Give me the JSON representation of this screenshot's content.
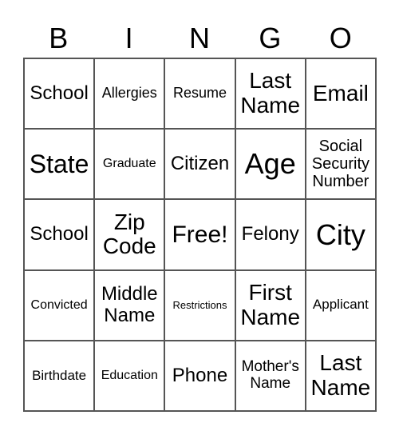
{
  "header": [
    "B",
    "I",
    "N",
    "G",
    "O"
  ],
  "cells": [
    "School",
    "Allergies",
    "Resume",
    "Last Name",
    "Email",
    "State",
    "Graduate",
    "Citizen",
    "Age",
    "Social Security Number",
    "School",
    "Zip Code",
    "Free!",
    "Felony",
    "City",
    "Convicted",
    "Middle Name",
    "Restrictions",
    "First Name",
    "Applicant",
    "Birthdate",
    "Education",
    "Phone",
    "Mother's Name",
    "Last Name"
  ]
}
